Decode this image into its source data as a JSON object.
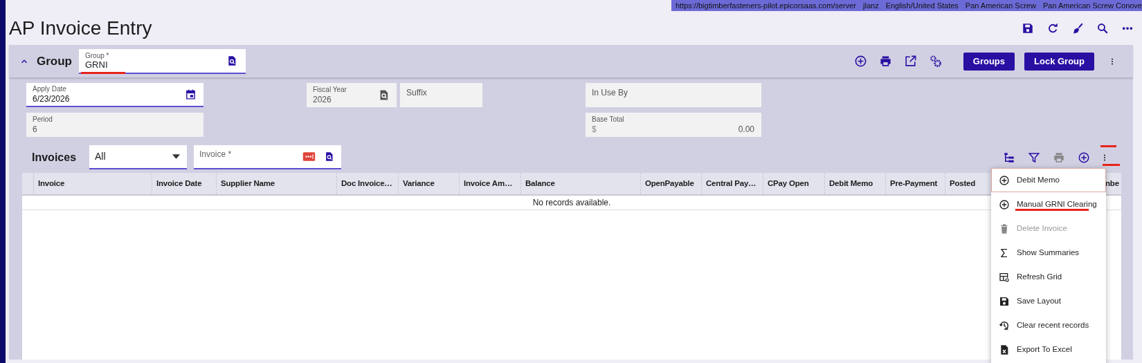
{
  "info_bar": [
    "https://bigtimberfasteners-pilot.epicorsaas.com/server",
    "jlanz",
    "English/United States",
    "Pan American Screw",
    "Pan American Screw Conove"
  ],
  "title": "AP Invoice Entry",
  "group_panel": {
    "expanded": true,
    "title": "Group",
    "group_field": {
      "label": "Group *",
      "value": "GRNI"
    },
    "buttons": [
      "Groups",
      "Lock Group"
    ]
  },
  "fields": {
    "apply_date": {
      "label": "Apply Date",
      "value": "6/23/2026"
    },
    "period": {
      "label": "Period",
      "value": "6"
    },
    "fiscal_year": {
      "label": "Fiscal Year",
      "value": "2026"
    },
    "suffix": {
      "label": "Suffix"
    },
    "in_use_by": {
      "label": "In Use By"
    },
    "base_total": {
      "label": "Base Total",
      "prefix": "$",
      "value": "0.00"
    }
  },
  "invoices": {
    "title": "Invoices",
    "filter": "All",
    "invoice_field": {
      "placeholder": "Invoice *"
    },
    "columns": [
      "Invoice",
      "Invoice Date",
      "Supplier Name",
      "Doc Invoice…",
      "Variance",
      "Invoice Am…",
      "Balance",
      "OpenPayable",
      "Central Pay…",
      "CPay Open",
      "Debit Memo",
      "Pre-Payment",
      "Posted",
      "nbe"
    ],
    "empty_message": "No records available.",
    "menu": [
      {
        "kind": "add",
        "label": "Debit Memo",
        "selected": true,
        "disabled": false
      },
      {
        "kind": "add",
        "label": "Manual GRNI Clearing",
        "selected": false,
        "disabled": false
      },
      {
        "kind": "delete",
        "label": "Delete Invoice",
        "selected": false,
        "disabled": true
      },
      {
        "kind": "sum",
        "label": "Show Summaries",
        "selected": false,
        "disabled": false
      },
      {
        "kind": "grid",
        "label": "Refresh Grid",
        "selected": false,
        "disabled": false
      },
      {
        "kind": "save",
        "label": "Save Layout",
        "selected": false,
        "disabled": false
      },
      {
        "kind": "history",
        "label": "Clear recent records",
        "selected": false,
        "disabled": false
      },
      {
        "kind": "excel",
        "label": "Export To Excel",
        "selected": false,
        "disabled": false
      }
    ]
  }
}
